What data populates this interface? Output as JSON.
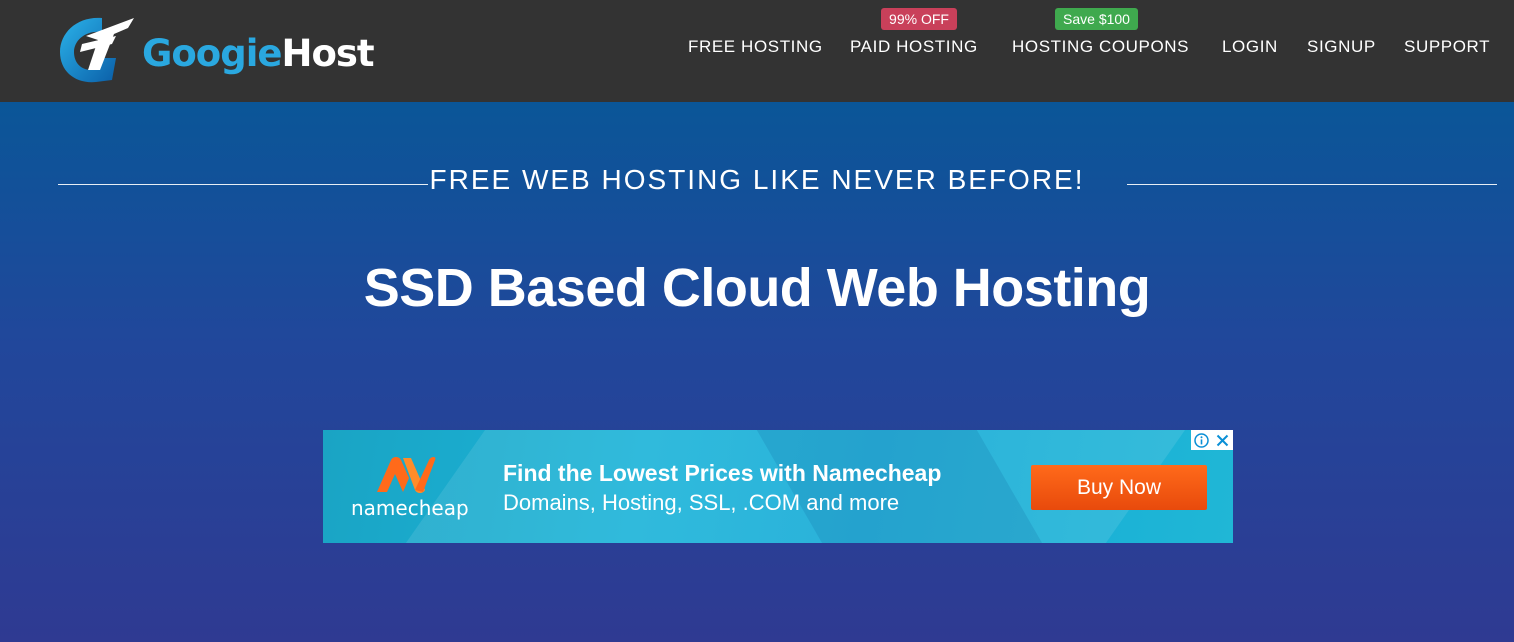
{
  "brand": {
    "name_prefix": "Googie",
    "name_suffix": "Host"
  },
  "nav": {
    "items": [
      {
        "label": "FREE HOSTING"
      },
      {
        "label": "PAID HOSTING",
        "badge": "99% OFF"
      },
      {
        "label": "HOSTING COUPONS",
        "badge": "Save $100"
      },
      {
        "label": "LOGIN"
      },
      {
        "label": "SIGNUP"
      },
      {
        "label": "SUPPORT"
      }
    ]
  },
  "hero": {
    "tagline": "FREE WEB HOSTING LIKE NEVER BEFORE!",
    "headline": "SSD Based Cloud Web Hosting"
  },
  "ad": {
    "brand": "namecheap",
    "line1": "Find the Lowest Prices with Namecheap",
    "line2": "Domains, Hosting, SSL, .COM and more",
    "cta": "Buy Now",
    "info_icon": "info-icon",
    "close_icon": "close-icon"
  },
  "colors": {
    "header_bg": "#333333",
    "badge_red": "#c9405a",
    "badge_green": "#3fa94e",
    "cta_orange": "#f25a14",
    "brand_blue": "#2aa8e0"
  }
}
